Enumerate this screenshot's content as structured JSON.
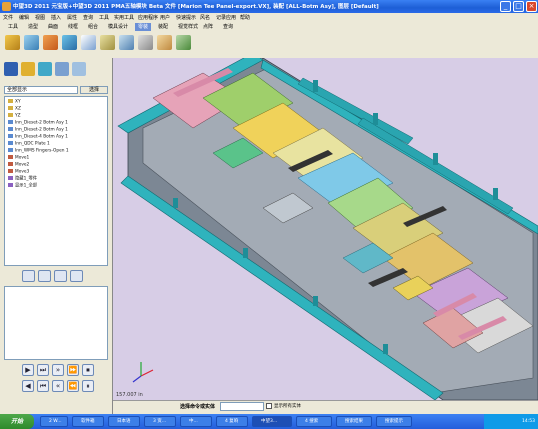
{
  "window": {
    "title": "中望3D 2011 元宝版+中望3D 2011 PMA五轴模块 Beta          文件 [Marion Tee Panel-export.VX], 装配 [ALL-Botm Asy], 图层 [Default]",
    "icon": "app-icon",
    "controls": [
      "minimize",
      "maximize",
      "close"
    ]
  },
  "menu": [
    "文件",
    "编辑",
    "视图",
    "插入",
    "属性",
    "查询",
    "工具",
    "实用工具",
    "应用程序",
    "用户",
    "快速提示",
    "风名",
    "记录应用",
    "帮助"
  ],
  "tabs": [
    "工具",
    "造型",
    "曲面",
    "线框",
    "组合",
    "模具设计",
    "零装",
    "装配",
    "视觉样式",
    "点阵",
    "查询"
  ],
  "active_tab": "零装",
  "panel": {
    "filter_value": "全部显示",
    "select_label": "选择",
    "tree": [
      {
        "label": "XY",
        "icon": "plane-icon"
      },
      {
        "label": "XZ",
        "icon": "plane-icon"
      },
      {
        "label": "YZ",
        "icon": "plane-icon"
      },
      {
        "label": "Inn_Dieset-2 Botm Asy 1",
        "icon": "part-icon"
      },
      {
        "label": "Inn_Dieset-2 Botm Asy 1",
        "icon": "part-icon"
      },
      {
        "label": "Inn_Dieset-4 Botm Asy 1",
        "icon": "part-icon"
      },
      {
        "label": "Inn_QDC Plate 1",
        "icon": "part-icon"
      },
      {
        "label": "Inn_WMS Fingers-Open 1",
        "icon": "part-icon"
      },
      {
        "label": "Move1",
        "icon": "feature-icon"
      },
      {
        "label": "Move2",
        "icon": "feature-icon"
      },
      {
        "label": "Move3",
        "icon": "feature-icon"
      },
      {
        "label": "隐藏1_零件",
        "icon": "feature-icon"
      },
      {
        "label": "显示1_全部",
        "icon": "feature-icon"
      }
    ]
  },
  "viewport": {
    "coordinate": "157.007 in",
    "background": "#d7cde6"
  },
  "command": {
    "label": "选择命令或实体",
    "showall_label": "显示所有实体"
  },
  "taskbar": {
    "start": "开始",
    "tasks": [
      "2 W...",
      "软件箱",
      "日本语",
      "3 资...",
      "中...",
      "4 复响",
      "中望3...",
      "4 搜索",
      "搜索结果",
      "搜索提示"
    ],
    "clock": "14:53"
  }
}
